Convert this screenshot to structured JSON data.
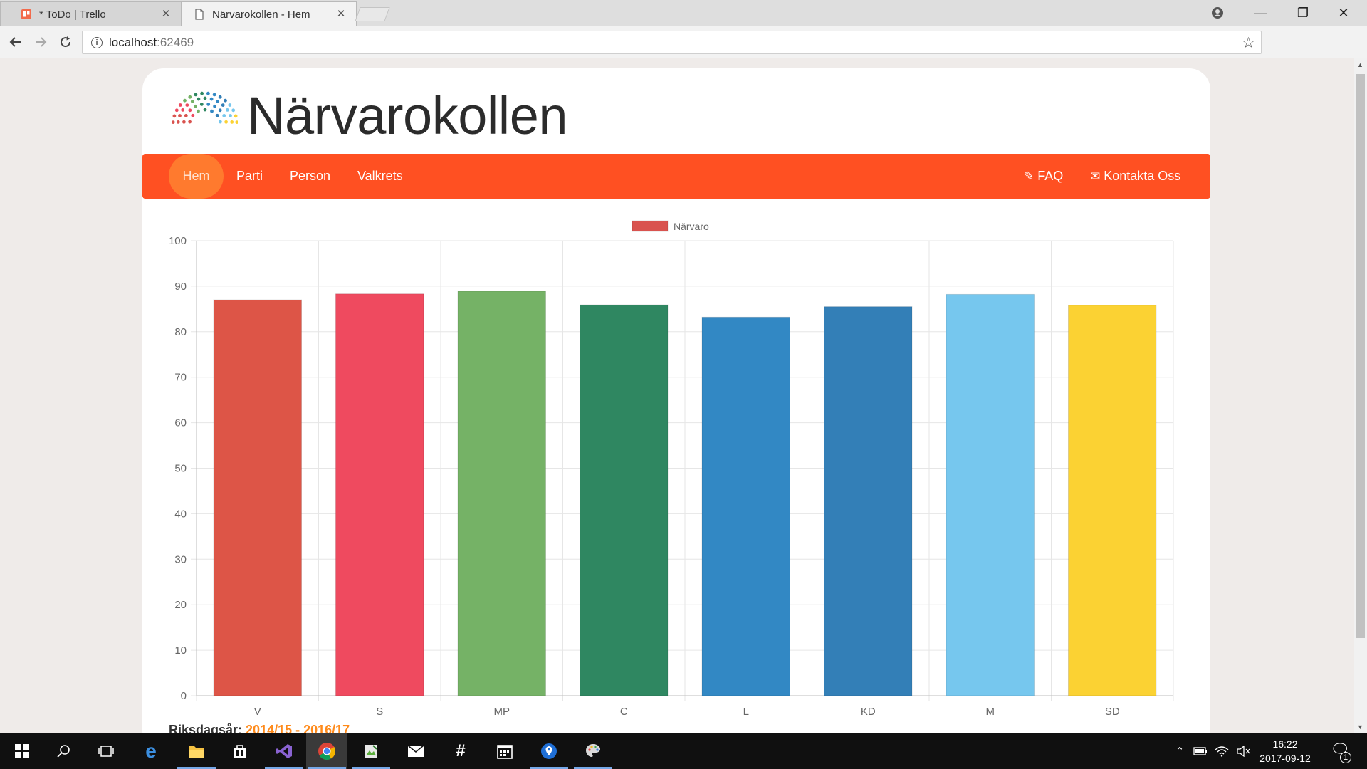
{
  "browser": {
    "tabs": [
      {
        "title": "* ToDo | Trello",
        "close": "✕"
      },
      {
        "title": "Närvarokollen - Hem",
        "close": "✕"
      }
    ],
    "address": {
      "host": "localhost",
      "port": ":62469"
    },
    "window_controls": {
      "minimize": "—",
      "maximize": "❐",
      "close": "✕"
    }
  },
  "site": {
    "title": "Närvarokollen",
    "nav": {
      "items": [
        "Hem",
        "Parti",
        "Person",
        "Valkrets"
      ],
      "faq": "FAQ",
      "contact": "Kontakta Oss"
    },
    "footer": {
      "label": "Riksdagsår: ",
      "years": "2014/15 - 2016/17"
    }
  },
  "chart_data": {
    "type": "bar",
    "legend": {
      "label": "Närvaro",
      "color": "#d9534f",
      "position": "top"
    },
    "categories": [
      "V",
      "S",
      "MP",
      "C",
      "L",
      "KD",
      "M",
      "SD"
    ],
    "values": [
      87.0,
      88.3,
      88.9,
      85.9,
      83.2,
      85.5,
      88.2,
      85.8
    ],
    "colors": [
      "#dd5547",
      "#ef4a5f",
      "#75b266",
      "#2f8761",
      "#3288c4",
      "#337fb7",
      "#76c7ee",
      "#fbd233"
    ],
    "ylim": [
      0,
      100
    ],
    "yticks": [
      0,
      10,
      20,
      30,
      40,
      50,
      60,
      70,
      80,
      90,
      100
    ],
    "grid": true
  },
  "taskbar": {
    "clock_time": "16:22",
    "clock_date": "2017-09-12",
    "notification_count": "1"
  }
}
